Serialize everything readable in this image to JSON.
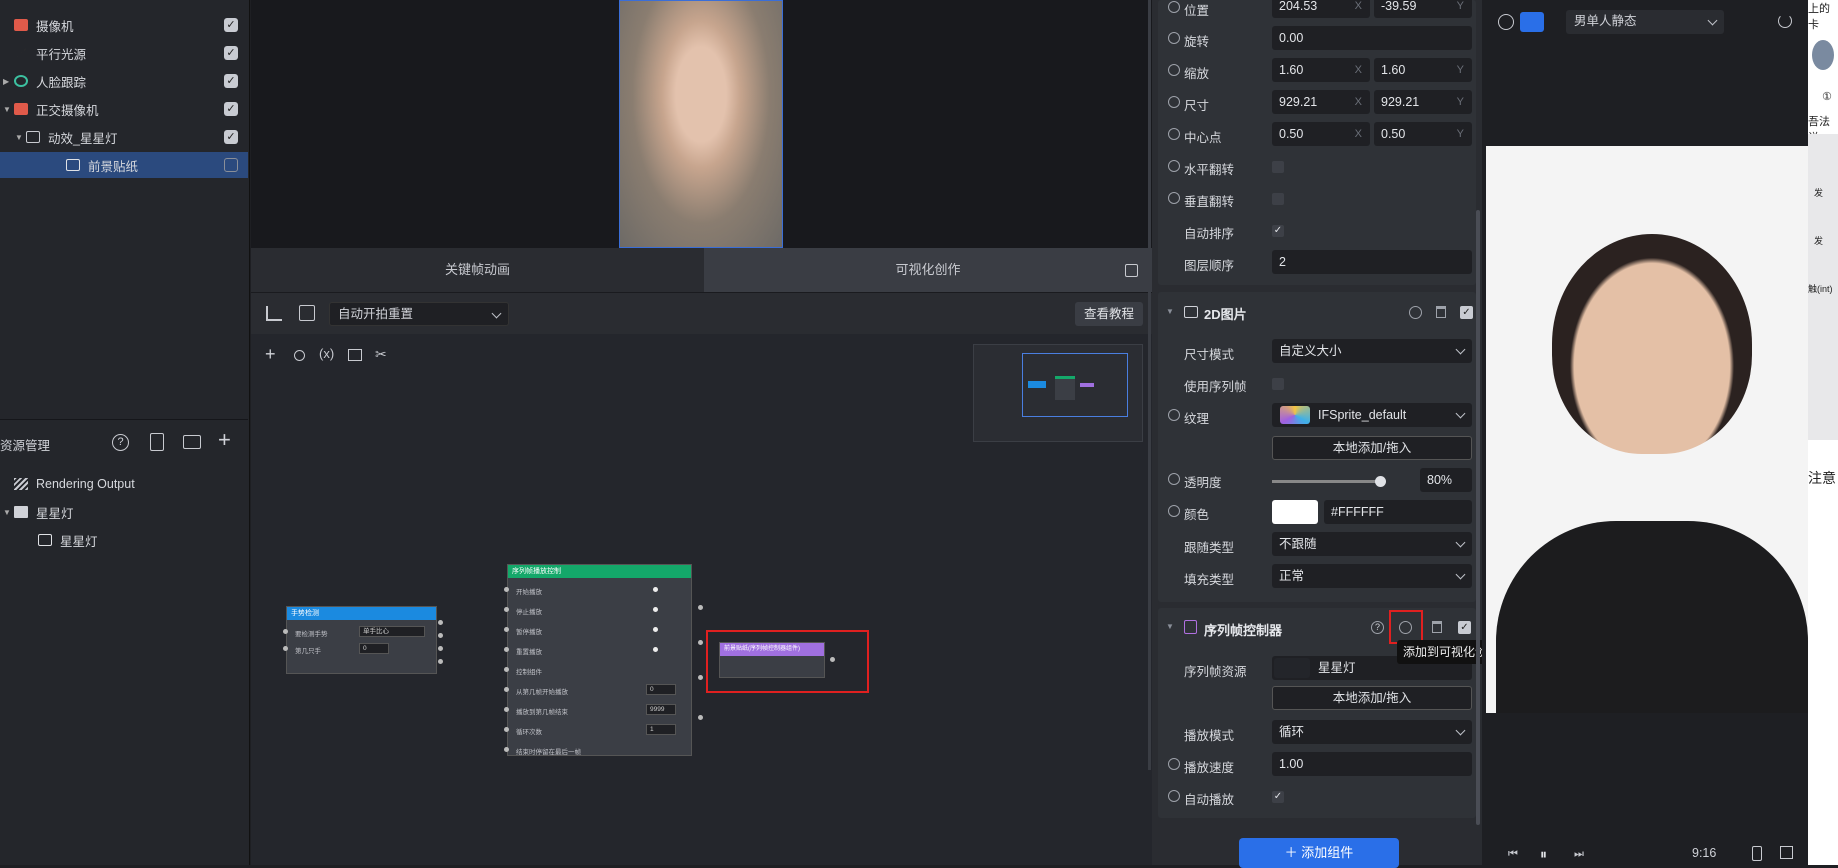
{
  "scene_tree": [
    {
      "label": "摄像机",
      "checked": true
    },
    {
      "label": "平行光源",
      "checked": true
    },
    {
      "label": "人脸跟踪",
      "checked": true
    },
    {
      "label": "正交摄像机",
      "checked": true
    },
    {
      "label": "动效_星星灯",
      "checked": true
    },
    {
      "label": "前景贴纸",
      "checked": false
    }
  ],
  "assets": {
    "title": "资源管理",
    "items": [
      "Rendering Output",
      "星星灯",
      "星星灯"
    ]
  },
  "center": {
    "tabs": [
      "关键帧动画",
      "可视化创作"
    ],
    "dropdown": "自动开拍重置",
    "tutorial": "查看教程"
  },
  "nodes": {
    "face": {
      "title": "手势检测",
      "rows": [
        {
          "label": "要检测手势",
          "value": "单手比心"
        },
        {
          "label": "第几只手",
          "value": "0"
        }
      ]
    },
    "seq": {
      "title": "序列帧播放控制",
      "rows": [
        "开始播放",
        "停止播放",
        "暂停播放",
        "重置播放",
        "控制组件",
        "从第几帧开始播放",
        "播放到第几帧结束",
        "循环次数",
        "结束时停留在最后一帧"
      ],
      "values": [
        "0",
        "9999",
        "1"
      ]
    },
    "sticker": {
      "title": "前景贴纸(序列帧控制器组件)"
    }
  },
  "props": {
    "transform": [
      {
        "label": "位置",
        "x": "204.53",
        "y": "-39.59"
      },
      {
        "label": "旋转",
        "v": "0.00"
      },
      {
        "label": "缩放",
        "x": "1.60",
        "y": "1.60"
      },
      {
        "label": "尺寸",
        "x": "929.21",
        "y": "929.21"
      },
      {
        "label": "中心点",
        "x": "0.50",
        "y": "0.50"
      },
      {
        "label": "水平翻转"
      },
      {
        "label": "垂直翻转"
      },
      {
        "label": "自动排序"
      },
      {
        "label": "图层顺序",
        "v": "2"
      }
    ],
    "axis_x": "X",
    "axis_y": "Y",
    "image2d": {
      "title": "2D图片",
      "size_mode_label": "尺寸模式",
      "size_mode": "自定义大小",
      "use_seq_label": "使用序列帧",
      "texture_label": "纹理",
      "texture": "IFSprite_default",
      "local_add": "本地添加/拖入",
      "opacity_label": "透明度",
      "opacity": "80%",
      "opacity_value": 0.8,
      "color_label": "颜色",
      "color": "#FFFFFF",
      "follow_label": "跟随类型",
      "follow": "不跟随",
      "fill_label": "填充类型",
      "fill": "正常"
    },
    "seqctrl": {
      "title": "序列帧控制器",
      "tooltip": "添加到可视化创作",
      "res_label": "序列帧资源",
      "res": "星星灯",
      "local_add": "本地添加/拖入",
      "mode_label": "播放模式",
      "mode": "循环",
      "speed_label": "播放速度",
      "speed": "1.00",
      "auto_label": "自动播放"
    },
    "add_component": "添加组件"
  },
  "preview": {
    "effect": "男单人静态",
    "ratio": "9:16"
  },
  "edge_texts": [
    "上的卡",
    "①",
    "吾法说",
    "发",
    "发",
    "触(int)",
    "注意"
  ]
}
